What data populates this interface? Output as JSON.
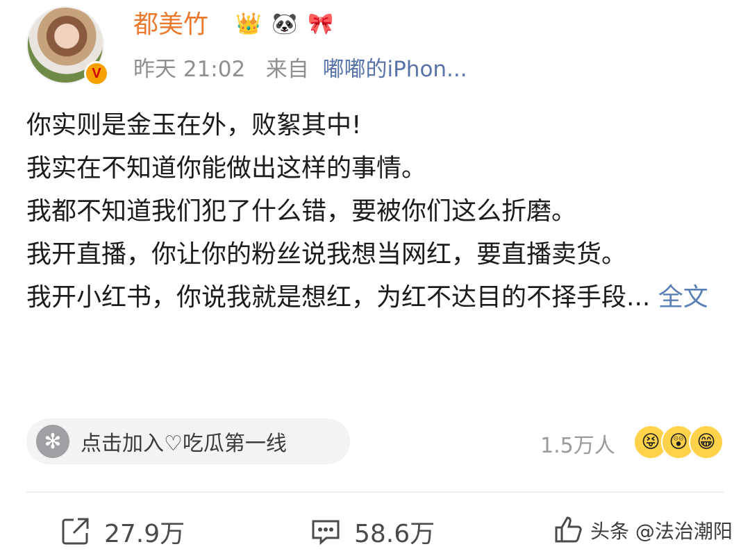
{
  "post": {
    "username": "都美竹",
    "verified_mark": "V",
    "badges": [
      "crown-badge",
      "panda-badge",
      "ribbon-badge"
    ],
    "time": "昨天 21:02",
    "source_prefix": "来自",
    "source": "嘟嘟的iPhon...",
    "lines": [
      "你实则是金玉在外，败絮其中!",
      "我实在不知道你能做出这样的事情。",
      "我都不知道我们犯了什么错，要被你们这么折磨。",
      "我开直播，你让你的粉丝说我想当网红，要直播卖货。",
      "我开小红书，你说我就是想红，为红不达目的不择手段..."
    ],
    "full_text_link": "全文"
  },
  "topic": {
    "label": "点击加入♡吃瓜第一线",
    "count": "1.5万人",
    "emojis": [
      "😝",
      "😲",
      "😁"
    ]
  },
  "actions": {
    "repost": "27.9万",
    "comment": "58.6万",
    "like": ""
  },
  "watermark": "头条 @法治潮阳",
  "colors": {
    "username": "#eb7a2e",
    "link": "#5b80b5",
    "meta": "#8f8f8f"
  }
}
